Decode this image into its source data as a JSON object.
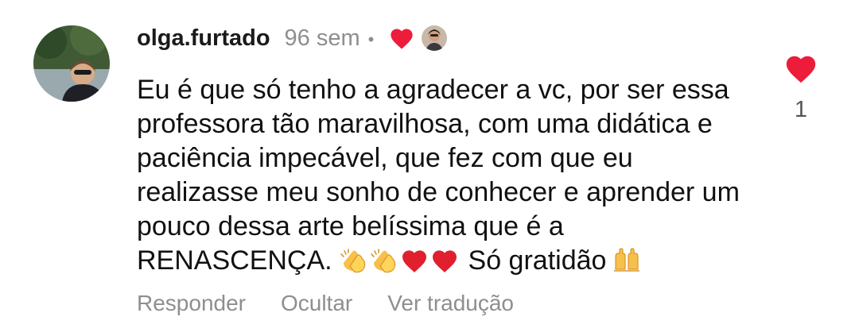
{
  "comment": {
    "username": "olga.furtado",
    "timestamp": "96 sem",
    "separator": "•",
    "text_before_emoji": "Eu é que só tenho a agradecer a vc, por ser essa professora tão maravilhosa, com uma didática e paciência impecável, que fez com que eu realizasse meu sonho de conhecer e aprender um pouco dessa arte belíssima que é a RENASCENÇA.",
    "text_after_emoji": "Só gratidão",
    "emojis_inline": [
      "clapping-hands-emoji",
      "clapping-hands-emoji",
      "red-heart-emoji",
      "red-heart-emoji"
    ],
    "emoji_trailing": "raising-hands-emoji",
    "creator_liked": true
  },
  "like": {
    "count": "1",
    "icon": "heart-icon",
    "liked": true
  },
  "actions": {
    "reply": "Responder",
    "hide": "Ocultar",
    "translate": "Ver tradução"
  },
  "colors": {
    "heart": "#ED1C3B",
    "muted_text": "#8E8E8E",
    "body_text": "#111111"
  }
}
